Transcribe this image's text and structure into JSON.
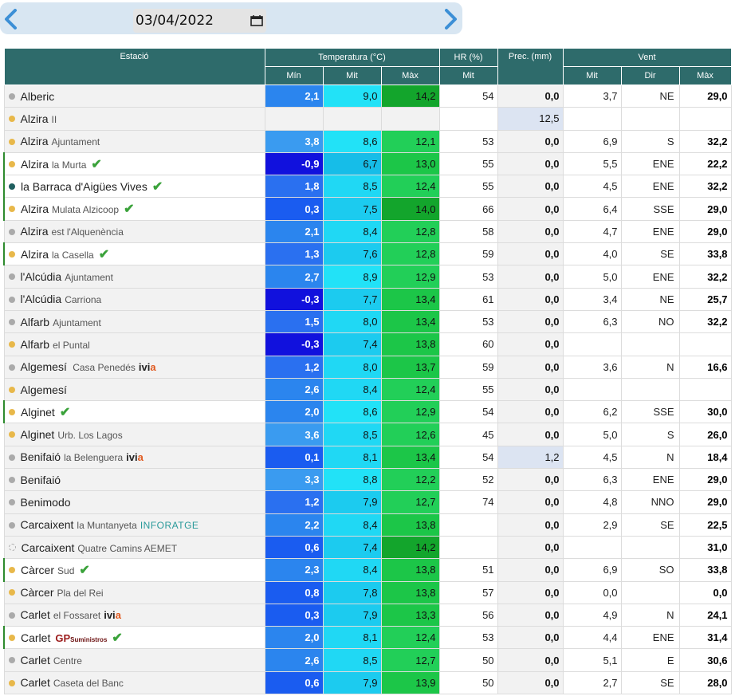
{
  "header": {
    "date": "03/04/2022"
  },
  "table": {
    "col_station": "Estació",
    "col_temp": "Temperatura (°C)",
    "col_hr": "HR (%)",
    "col_prec": "Prec. (mm)",
    "col_wind": "Vent",
    "sub_min": "Mín",
    "sub_mit": "Mit",
    "sub_max": "Màx",
    "sub_hr_mit": "Mit",
    "sub_wind_mit": "Mit",
    "sub_wind_dir": "Dir",
    "sub_wind_max": "Màx"
  },
  "colors": {
    "header_bg": "#2e6b6b",
    "dot_yellow": "#e8b84a",
    "dot_grey": "#aaaaaa",
    "dot_dark": "#1f5f5f",
    "check": "#3aa23a"
  },
  "rows": [
    {
      "name": "Alberic",
      "sub": "",
      "badge": "",
      "dot": "grey",
      "sel": false,
      "tmin": "2,1",
      "tmit": "9,0",
      "tmax": "14,2",
      "hr": "54",
      "prec": "0,0",
      "wmit": "3,7",
      "wdir": "NE",
      "wmax": "29,0"
    },
    {
      "name": "Alzira",
      "sub": "II",
      "badge": "",
      "dot": "yellow",
      "sel": false,
      "tmin": "",
      "tmit": "",
      "tmax": "",
      "hr": "",
      "prec": "12,5",
      "precHl": true,
      "wmit": "",
      "wdir": "",
      "wmax": ""
    },
    {
      "name": "Alzira",
      "sub": "Ajuntament",
      "badge": "",
      "dot": "yellow",
      "sel": false,
      "tmin": "3,8",
      "tmit": "8,6",
      "tmax": "12,1",
      "hr": "53",
      "prec": "0,0",
      "wmit": "6,9",
      "wdir": "S",
      "wmax": "32,2"
    },
    {
      "name": "Alzira",
      "sub": "la Murta",
      "badge": "check",
      "dot": "yellow",
      "sel": true,
      "tmin": "-0,9",
      "tmit": "6,7",
      "tmax": "13,0",
      "hr": "55",
      "prec": "0,0",
      "wmit": "5,5",
      "wdir": "ENE",
      "wmax": "22,2"
    },
    {
      "name": "la Barraca d'Aigües Vives",
      "sub": "",
      "badge": "check",
      "dot": "dark",
      "sel": true,
      "tmin": "1,8",
      "tmit": "8,5",
      "tmax": "12,4",
      "hr": "55",
      "prec": "0,0",
      "wmit": "4,5",
      "wdir": "ENE",
      "wmax": "32,2"
    },
    {
      "name": "Alzira",
      "sub": "Mulata Alzicoop",
      "badge": "check",
      "dot": "yellow",
      "sel": true,
      "tmin": "0,3",
      "tmit": "7,5",
      "tmax": "14,0",
      "hr": "66",
      "prec": "0,0",
      "wmit": "6,4",
      "wdir": "SSE",
      "wmax": "29,0"
    },
    {
      "name": "Alzira",
      "sub": "est l'Alquenència",
      "badge": "",
      "dot": "grey",
      "sel": false,
      "tmin": "2,1",
      "tmit": "8,4",
      "tmax": "12,8",
      "hr": "58",
      "prec": "0,0",
      "wmit": "4,7",
      "wdir": "ENE",
      "wmax": "29,0"
    },
    {
      "name": "Alzira",
      "sub": "la Casella",
      "badge": "check",
      "dot": "yellow",
      "sel": true,
      "tmin": "1,3",
      "tmit": "7,6",
      "tmax": "12,8",
      "hr": "59",
      "prec": "0,0",
      "wmit": "4,0",
      "wdir": "SE",
      "wmax": "33,8"
    },
    {
      "name": "l'Alcúdia",
      "sub": "Ajuntament",
      "badge": "",
      "dot": "grey",
      "sel": false,
      "tmin": "2,7",
      "tmit": "8,9",
      "tmax": "12,9",
      "hr": "53",
      "prec": "0,0",
      "wmit": "5,0",
      "wdir": "ENE",
      "wmax": "32,2"
    },
    {
      "name": "l'Alcúdia",
      "sub": "Carriona",
      "badge": "",
      "dot": "grey",
      "sel": false,
      "tmin": "-0,3",
      "tmit": "7,7",
      "tmax": "13,4",
      "hr": "61",
      "prec": "0,0",
      "wmit": "3,4",
      "wdir": "NE",
      "wmax": "25,7"
    },
    {
      "name": "Alfarb",
      "sub": "Ajuntament",
      "badge": "",
      "dot": "grey",
      "sel": false,
      "tmin": "1,5",
      "tmit": "8,0",
      "tmax": "13,4",
      "hr": "53",
      "prec": "0,0",
      "wmit": "6,3",
      "wdir": "NO",
      "wmax": "32,2"
    },
    {
      "name": "Alfarb",
      "sub": "el Puntal",
      "badge": "",
      "dot": "yellow",
      "sel": false,
      "tmin": "-0,3",
      "tmit": "7,4",
      "tmax": "13,8",
      "hr": "60",
      "prec": "0,0",
      "wmit": "",
      "wdir": "",
      "wmax": ""
    },
    {
      "name": "Algemesí",
      "sub": " Casa Penedés",
      "badge": "ivia",
      "dot": "grey",
      "sel": false,
      "tmin": "1,2",
      "tmit": "8,0",
      "tmax": "13,7",
      "hr": "59",
      "prec": "0,0",
      "wmit": "3,6",
      "wdir": "N",
      "wmax": "16,6"
    },
    {
      "name": "Algemesí",
      "sub": "",
      "badge": "",
      "dot": "yellow",
      "sel": false,
      "tmin": "2,6",
      "tmit": "8,4",
      "tmax": "12,4",
      "hr": "55",
      "prec": "0,0",
      "wmit": "",
      "wdir": "",
      "wmax": ""
    },
    {
      "name": "Alginet",
      "sub": "",
      "badge": "check",
      "dot": "yellow",
      "sel": true,
      "tmin": "2,0",
      "tmit": "8,6",
      "tmax": "12,9",
      "hr": "54",
      "prec": "0,0",
      "wmit": "6,2",
      "wdir": "SSE",
      "wmax": "30,0"
    },
    {
      "name": "Alginet",
      "sub": "Urb. Los Lagos",
      "badge": "",
      "dot": "yellow",
      "sel": false,
      "tmin": "3,6",
      "tmit": "8,5",
      "tmax": "12,6",
      "hr": "45",
      "prec": "0,0",
      "wmit": "5,0",
      "wdir": "S",
      "wmax": "26,0"
    },
    {
      "name": "Benifaió",
      "sub": "la Belenguera",
      "badge": "ivia",
      "dot": "grey",
      "sel": false,
      "tmin": "0,1",
      "tmit": "8,1",
      "tmax": "13,4",
      "hr": "54",
      "prec": "1,2",
      "precHl": true,
      "wmit": "4,5",
      "wdir": "N",
      "wmax": "18,4"
    },
    {
      "name": "Benifaió",
      "sub": "",
      "badge": "",
      "dot": "grey",
      "sel": false,
      "tmin": "3,3",
      "tmit": "8,8",
      "tmax": "12,2",
      "hr": "52",
      "prec": "0,0",
      "wmit": "6,3",
      "wdir": "ENE",
      "wmax": "29,0"
    },
    {
      "name": "Benimodo",
      "sub": "",
      "badge": "",
      "dot": "grey",
      "sel": false,
      "tmin": "1,2",
      "tmit": "7,9",
      "tmax": "12,7",
      "hr": "74",
      "prec": "0,0",
      "wmit": "4,8",
      "wdir": "NNO",
      "wmax": "29,0"
    },
    {
      "name": "Carcaixent",
      "sub": "la Muntanyeta",
      "badge": "info",
      "dot": "grey",
      "sel": false,
      "tmin": "2,2",
      "tmit": "8,4",
      "tmax": "13,8",
      "hr": "",
      "prec": "0,0",
      "wmit": "2,9",
      "wdir": "SE",
      "wmax": "22,5"
    },
    {
      "name": "Carcaixent",
      "sub": "Quatre Camins AEMET",
      "badge": "",
      "dot": "empty",
      "sel": false,
      "tmin": "0,6",
      "tmit": "7,4",
      "tmax": "14,2",
      "hr": "",
      "prec": "0,0",
      "wmit": "",
      "wdir": "",
      "wmax": "31,0"
    },
    {
      "name": "Càrcer",
      "sub": "Sud",
      "badge": "check",
      "dot": "yellow",
      "sel": true,
      "tmin": "2,3",
      "tmit": "8,4",
      "tmax": "13,8",
      "hr": "51",
      "prec": "0,0",
      "wmit": "6,9",
      "wdir": "SO",
      "wmax": "33,8"
    },
    {
      "name": "Càrcer",
      "sub": "Pla del Rei",
      "badge": "",
      "dot": "yellow",
      "sel": false,
      "tmin": "0,8",
      "tmit": "7,8",
      "tmax": "13,8",
      "hr": "57",
      "prec": "0,0",
      "wmit": "0,0",
      "wdir": "",
      "wmax": "0,0"
    },
    {
      "name": "Carlet",
      "sub": "el Fossaret",
      "badge": "ivia",
      "dot": "grey",
      "sel": false,
      "tmin": "0,3",
      "tmit": "7,9",
      "tmax": "13,3",
      "hr": "56",
      "prec": "0,0",
      "wmit": "4,9",
      "wdir": "N",
      "wmax": "24,1"
    },
    {
      "name": "Carlet",
      "sub": "",
      "badge": "gp",
      "dot": "yellow",
      "sel": true,
      "tmin": "2,0",
      "tmit": "8,1",
      "tmax": "12,4",
      "hr": "53",
      "prec": "0,0",
      "wmit": "4,4",
      "wdir": "ENE",
      "wmax": "31,4"
    },
    {
      "name": "Carlet",
      "sub": "Centre",
      "badge": "",
      "dot": "grey",
      "sel": false,
      "tmin": "2,6",
      "tmit": "8,5",
      "tmax": "12,7",
      "hr": "50",
      "prec": "0,0",
      "wmit": "5,1",
      "wdir": "E",
      "wmax": "30,6"
    },
    {
      "name": "Carlet",
      "sub": "Caseta del Banc",
      "badge": "",
      "dot": "yellow",
      "sel": false,
      "tmin": "0,6",
      "tmit": "7,9",
      "tmax": "13,9",
      "hr": "50",
      "prec": "0,0",
      "wmit": "2,7",
      "wdir": "SE",
      "wmax": "28,0"
    }
  ],
  "badges": {
    "ivia_a": "ivi",
    "ivia_b": "a",
    "info": "INFORATGE",
    "gp": "GP",
    "gp_sub": "Suministros",
    "check": "✔"
  }
}
